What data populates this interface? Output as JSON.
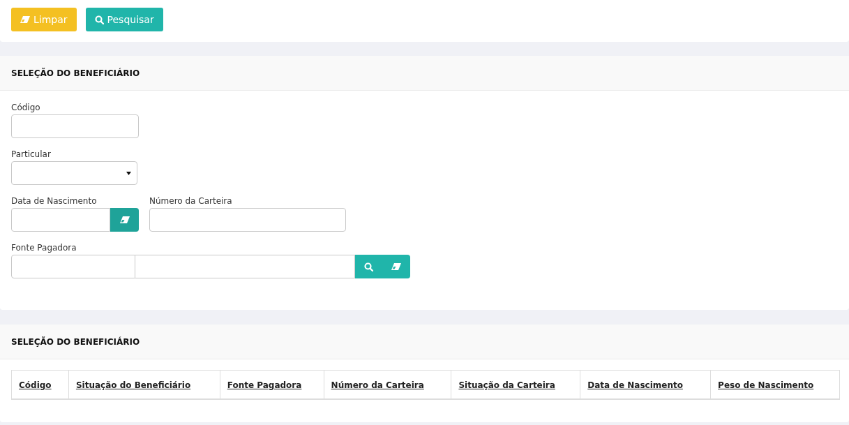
{
  "toolbar": {
    "buttons": [
      {
        "label": "Limpar",
        "kind": "clear"
      },
      {
        "label": "Pesquisar",
        "kind": "search"
      }
    ]
  },
  "filter_section": {
    "title": "SELEÇÃO DO BENEFICIÁRIO",
    "rows": [
      [
        {
          "label": "Código",
          "kind": "text"
        }
      ],
      [
        {
          "label": "Particular",
          "kind": "select"
        }
      ],
      [
        {
          "label": "Data de Nascimento",
          "kind": "date"
        },
        {
          "label": "Número da Carteira",
          "kind": "text"
        }
      ],
      [
        {
          "label": "Fonte Pagadora",
          "kind": "lookup"
        }
      ]
    ]
  },
  "results_section": {
    "title": "SELEÇÃO DO BENEFICIÁRIO",
    "table": {
      "columns": [
        "Código",
        "Situação do Beneficiário",
        "Fonte Pagadora",
        "Número da Carteira",
        "Situação da Carteira",
        "Data de Nascimento",
        "Peso de Nascimento"
      ]
    }
  }
}
